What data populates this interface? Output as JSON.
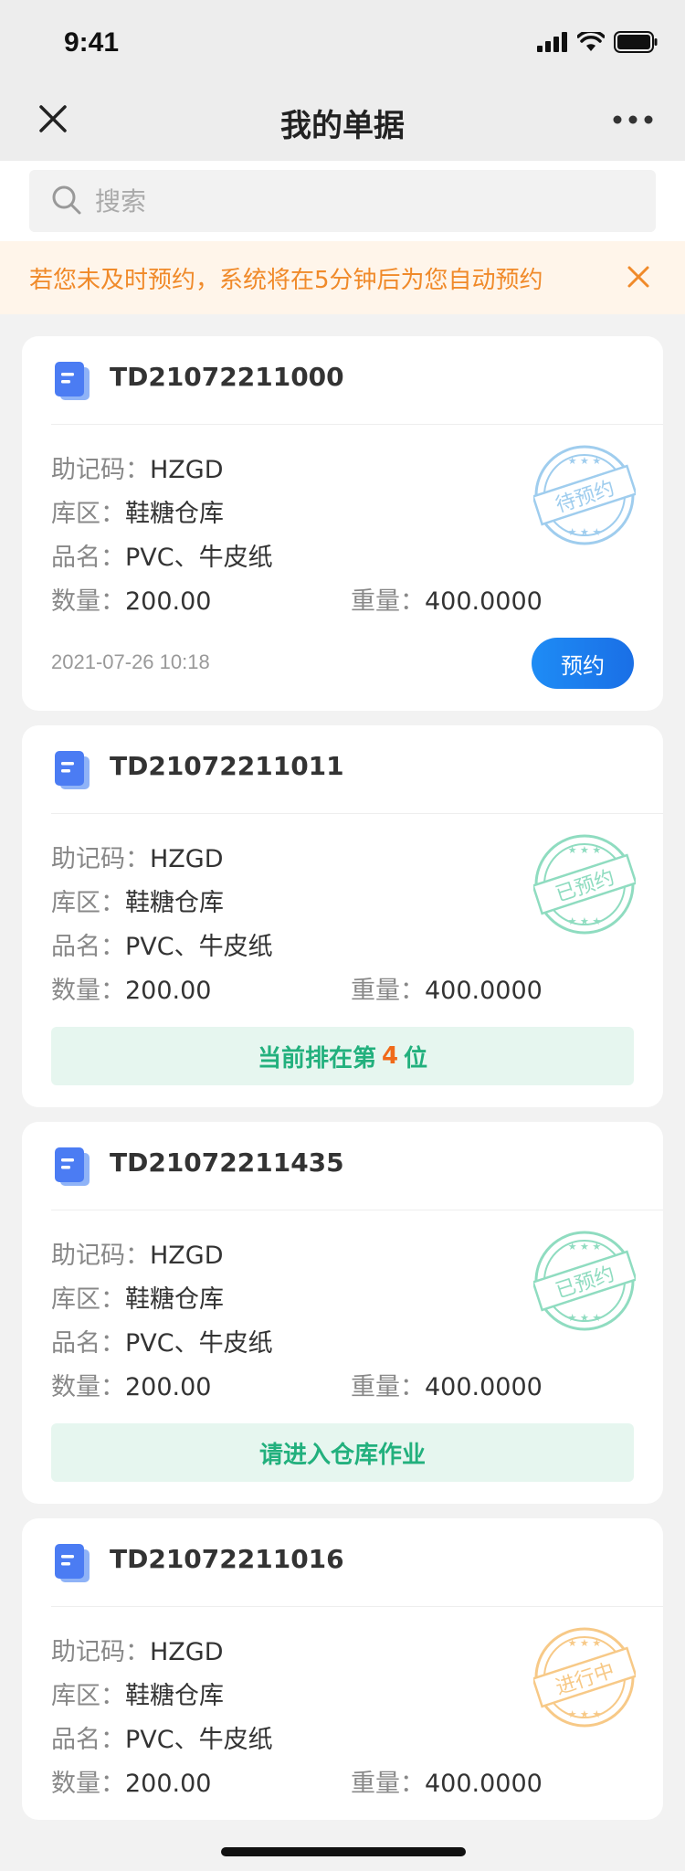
{
  "status_bar": {
    "time": "9:41"
  },
  "nav": {
    "title": "我的单据",
    "close_icon": "close-icon",
    "more_icon": "more-icon"
  },
  "search": {
    "placeholder": "搜索",
    "value": ""
  },
  "notice": {
    "text": "若您未及时预约，系统将在5分钟后为您自动预约",
    "color": "#f08a2a"
  },
  "labels": {
    "mnemonic": "助记码：",
    "zone": "库区：",
    "product": "品名：",
    "quantity": "数量：",
    "weight": "重量："
  },
  "cards": [
    {
      "id": "TD21072211000",
      "mnemonic": "HZGD",
      "zone": "鞋糖仓库",
      "product": "PVC、牛皮纸",
      "quantity": "200.00",
      "weight": "400.0000",
      "stamp": "待预约",
      "stamp_color": "#9fcdee",
      "time": "2021-07-26 10:18",
      "button": "预约"
    },
    {
      "id": "TD21072211011",
      "mnemonic": "HZGD",
      "zone": "鞋糖仓库",
      "product": "PVC、牛皮纸",
      "quantity": "200.00",
      "weight": "400.0000",
      "stamp": "已预约",
      "stamp_color": "#8fdcc0",
      "queue_prefix": "当前排在第",
      "queue_number": "4",
      "queue_suffix": "位"
    },
    {
      "id": "TD21072211435",
      "mnemonic": "HZGD",
      "zone": "鞋糖仓库",
      "product": "PVC、牛皮纸",
      "quantity": "200.00",
      "weight": "400.0000",
      "stamp": "已预约",
      "stamp_color": "#8fdcc0",
      "status_text": "请进入仓库作业"
    },
    {
      "id": "TD21072211016",
      "mnemonic": "HZGD",
      "zone": "鞋糖仓库",
      "product": "PVC、牛皮纸",
      "quantity": "200.00",
      "weight": "400.0000",
      "stamp": "进行中",
      "stamp_color": "#f7c987"
    }
  ]
}
